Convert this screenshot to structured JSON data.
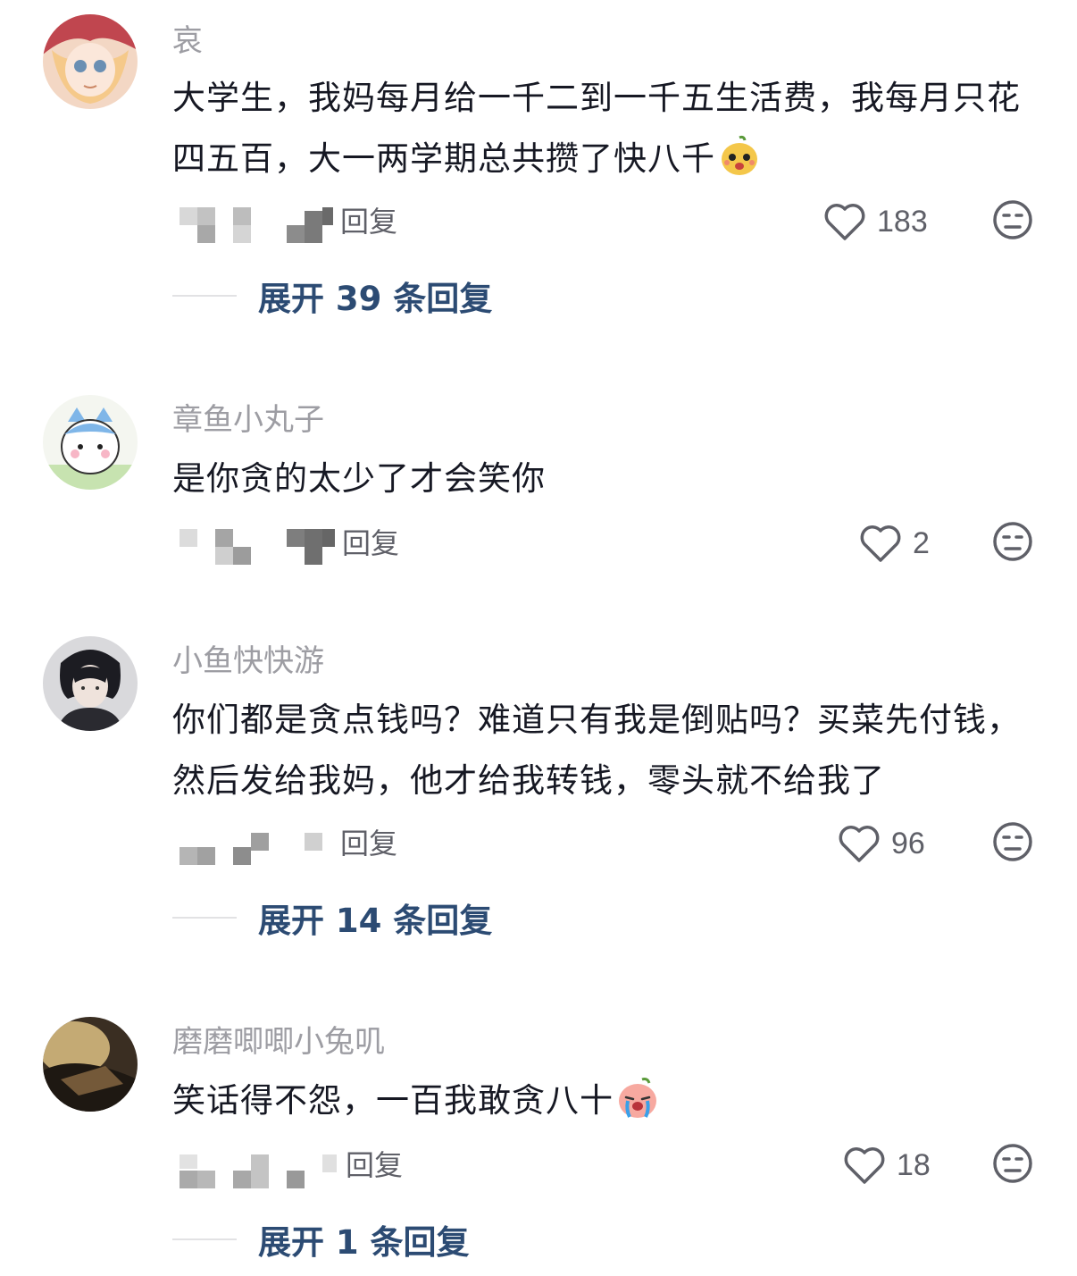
{
  "reply_label": "回复",
  "comments": [
    {
      "username": "哀",
      "text": "大学生，我妈每月给一千二到一千五生活费，我每月只花四五百，大一两学期总共攒了快八千",
      "emoji": "pear-face-emoji",
      "likes": "183",
      "expand": "展开 39 条回复"
    },
    {
      "username": "章鱼小丸子",
      "text": "是你贪的太少了才会笑你",
      "likes": "2"
    },
    {
      "username": "小鱼快快游",
      "text": "你们都是贪点钱吗？难道只有我是倒贴吗？买菜先付钱，然后发给我妈，他才给我转钱，零头就不给我了",
      "likes": "96",
      "expand": "展开 14 条回复"
    },
    {
      "username": "磨磨唧唧小兔叽",
      "text": "笑话得不怨，一百我敢贪八十",
      "emoji": "crying-peach-emoji",
      "likes": "18",
      "expand": "展开 1 条回复"
    }
  ],
  "colors": {
    "username": "#9d9da3",
    "text": "#161823",
    "meta": "#5f6068",
    "expand": "#2c4b73"
  },
  "icons": [
    "heart-outline-icon",
    "dislike-face-icon"
  ]
}
